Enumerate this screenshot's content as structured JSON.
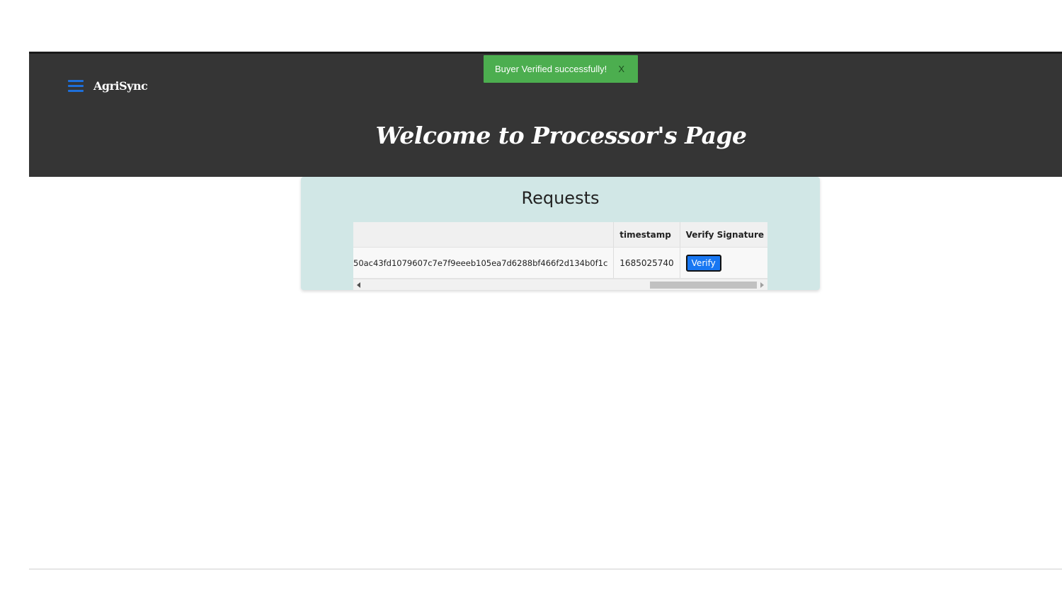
{
  "header": {
    "brand": "AgriSync",
    "welcome": "Welcome to Processor's Page",
    "accent_color": "#1e6fd9",
    "menu_icon": "hamburger-menu-icon"
  },
  "toast": {
    "message": "Buyer Verified successfully!",
    "close_label": "X",
    "color": "#4cae4f"
  },
  "requests": {
    "title": "Requests",
    "columns": [
      "",
      "timestamp",
      "Verify Signature"
    ],
    "rows": [
      {
        "hash": "50ac43fd1079607c7e7f9eeeb105ea7d6288bf466f2d134b0f1c",
        "timestamp": "1685025740",
        "action_label": "Verify"
      }
    ]
  }
}
